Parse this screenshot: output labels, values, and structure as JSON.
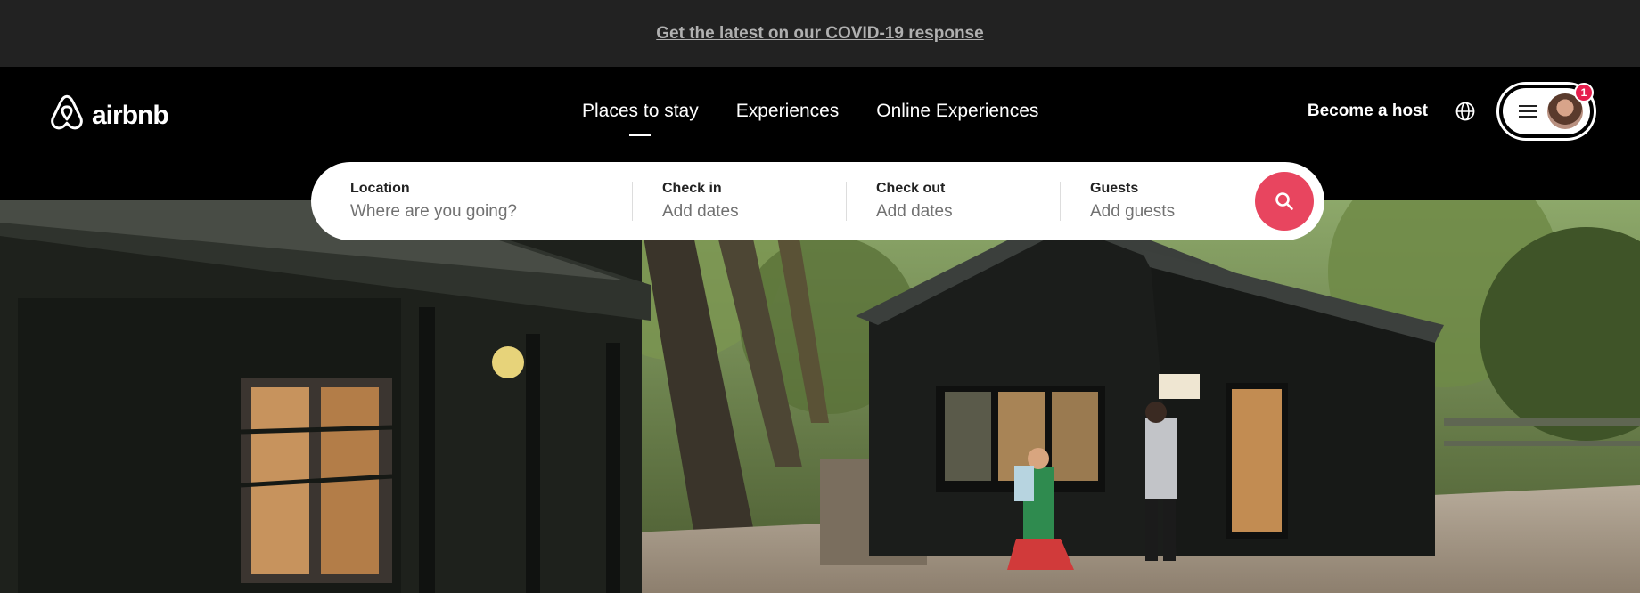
{
  "banner": {
    "link": "Get the latest on our COVID-19 response"
  },
  "header": {
    "logo_text": "airbnb",
    "nav": [
      "Places to stay",
      "Experiences",
      "Online Experiences"
    ],
    "become_host": "Become a host",
    "notification_count": "1"
  },
  "search": {
    "location": {
      "label": "Location",
      "placeholder": "Where are you going?"
    },
    "check_in": {
      "label": "Check in",
      "placeholder": "Add dates"
    },
    "check_out": {
      "label": "Check out",
      "placeholder": "Add dates"
    },
    "guests": {
      "label": "Guests",
      "placeholder": "Add guests"
    }
  },
  "icons": {
    "logo": "airbnb-belo-icon",
    "globe": "globe-icon",
    "menu": "hamburger-menu-icon",
    "search": "search-icon"
  },
  "colors": {
    "brand": "#e8455f",
    "badge": "#e61e4d",
    "banner_bg": "#222222",
    "header_bg": "#000000"
  }
}
